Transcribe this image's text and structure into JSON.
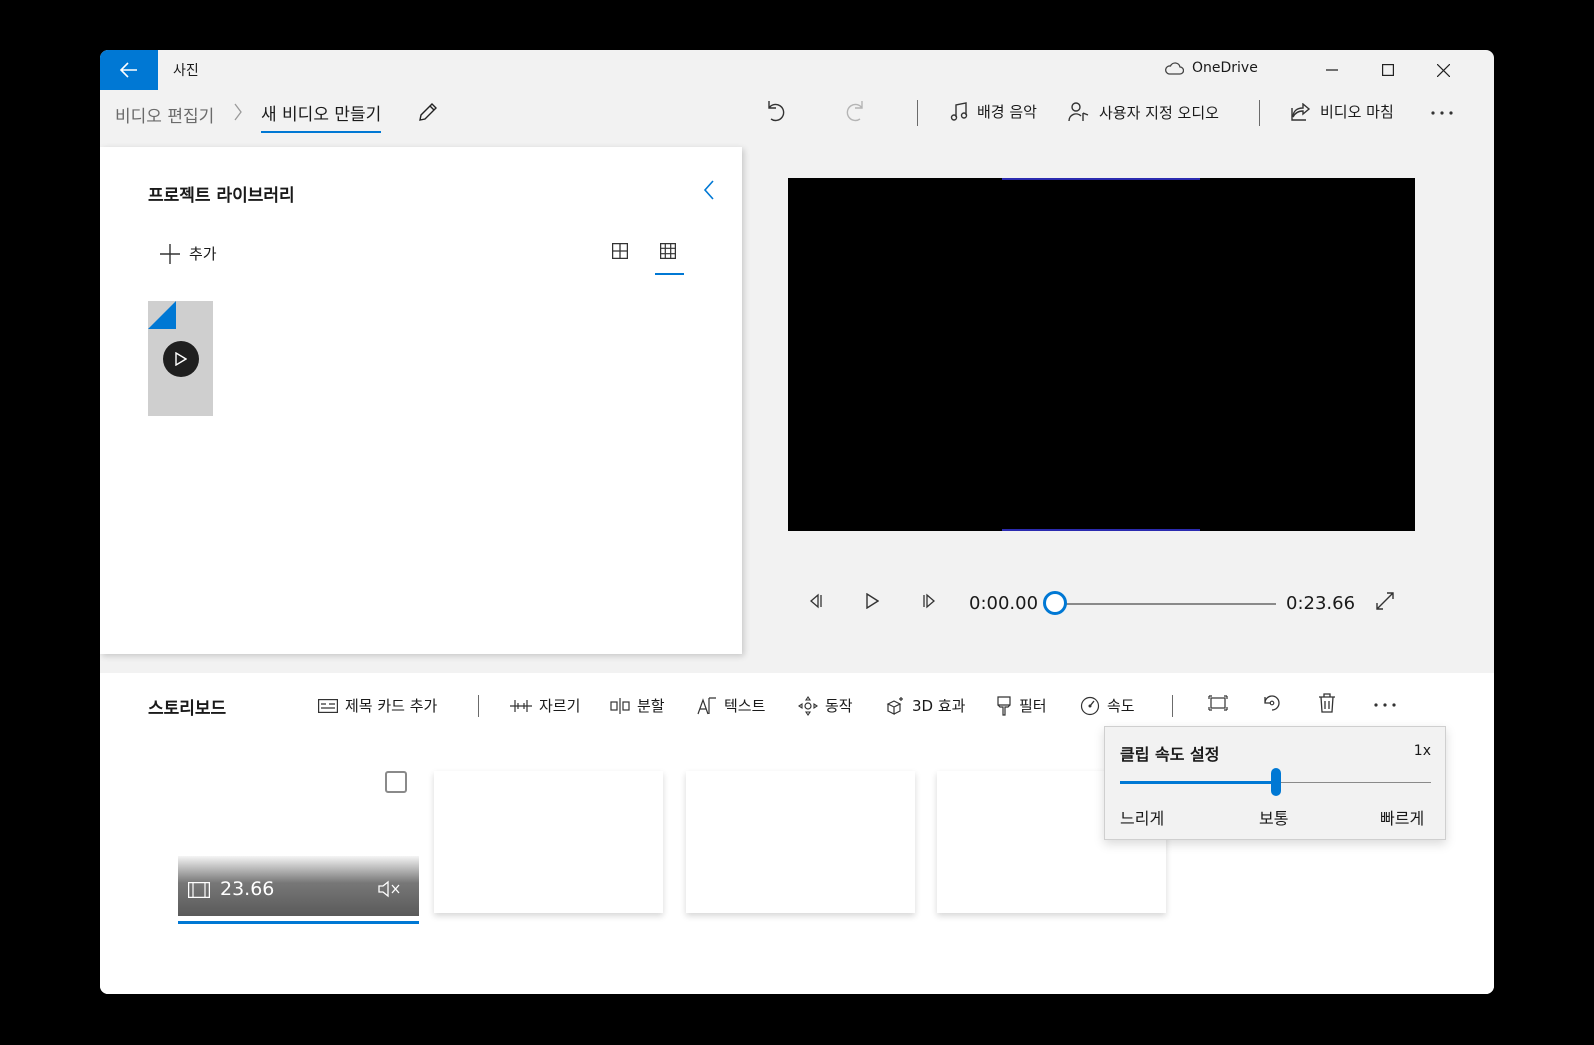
{
  "app": {
    "title": "사진",
    "onedrive": "OneDrive"
  },
  "breadcrumb": {
    "root": "비디오 편집기",
    "current": "새 비디오 만들기"
  },
  "toolbar": {
    "bg_music": "배경 음악",
    "custom_audio": "사용자 지정 오디오",
    "finish_video": "비디오 마침"
  },
  "library": {
    "title": "프로젝트 라이브러리",
    "add": "추가"
  },
  "player": {
    "current_time": "0:00.00",
    "total_time": "0:23.66",
    "progress": 0
  },
  "storyboard": {
    "title": "스토리보드",
    "tools": {
      "title_card": "제목 카드 추가",
      "trim": "자르기",
      "split": "분할",
      "text": "텍스트",
      "motion": "동작",
      "effects_3d": "3D 효과",
      "filters": "필터",
      "speed": "속도"
    },
    "clip": {
      "duration": "23.66"
    }
  },
  "speed_popup": {
    "title": "클립 속도 설정",
    "value": "1x",
    "slow": "느리게",
    "normal": "보통",
    "fast": "빠르게",
    "level": 0.5
  },
  "colors": {
    "accent": "#0078d4",
    "background": "#f2f2f2",
    "panel": "#ffffff"
  }
}
